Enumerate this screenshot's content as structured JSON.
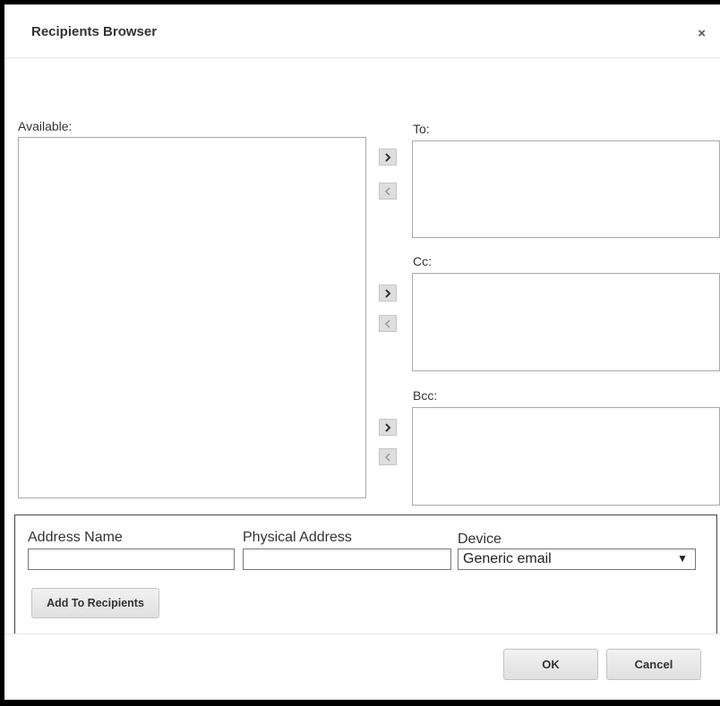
{
  "dialog": {
    "title": "Recipients Browser",
    "close_glyph": "×"
  },
  "lists": {
    "available_label": "Available:",
    "to_label": "To:",
    "cc_label": "Cc:",
    "bcc_label": "Bcc:"
  },
  "arrows": {
    "add": "add-right-arrow-icon",
    "remove": "remove-left-arrow-icon"
  },
  "form": {
    "address_name_label": "Address Name",
    "address_name_value": "",
    "physical_address_label": "Physical Address",
    "physical_address_value": "",
    "device_label": "Device",
    "device_selected": "Generic email",
    "add_button": "Add To Recipients"
  },
  "footer": {
    "ok": "OK",
    "cancel": "Cancel"
  }
}
